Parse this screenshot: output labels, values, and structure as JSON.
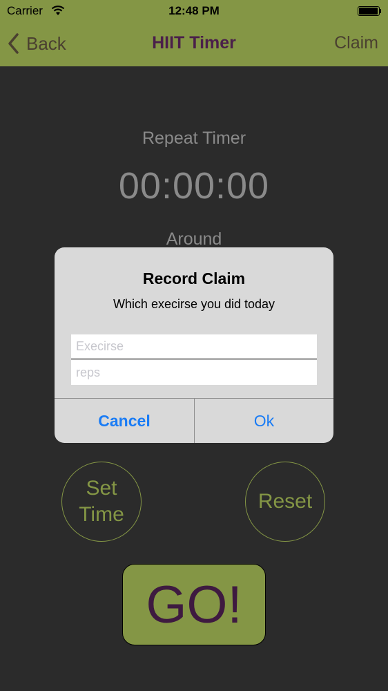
{
  "status_bar": {
    "carrier": "Carrier",
    "time": "12:48 PM"
  },
  "nav": {
    "back_label": "Back",
    "title": "HIIT Timer",
    "right_label": "Claim"
  },
  "timer": {
    "repeat_label": "Repeat Timer",
    "time": "00:00:00",
    "around_label": "Around"
  },
  "controls": {
    "set_time": "Set Time",
    "reset": "Reset",
    "go": "GO!"
  },
  "alert": {
    "title": "Record Claim",
    "message": "Which execirse you did today",
    "field1_placeholder": "Execirse",
    "field2_placeholder": "reps",
    "cancel": "Cancel",
    "ok": "Ok"
  },
  "colors": {
    "accent": "#849645",
    "background": "#2b2b2b",
    "title": "#4a1f4a",
    "alert_button": "#1a7cf5"
  }
}
